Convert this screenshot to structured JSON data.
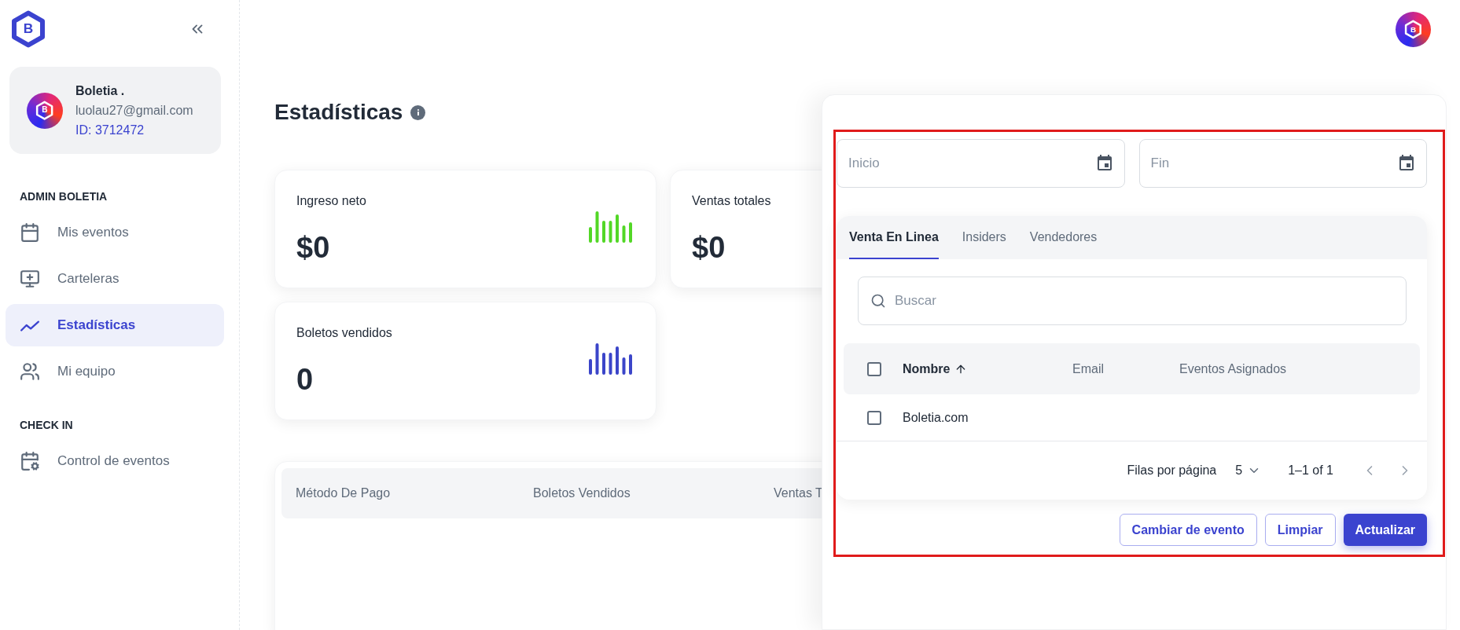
{
  "logo": {
    "letter": "B"
  },
  "profile": {
    "avatar_letter": "B",
    "name": "Boletia .",
    "email": "luolau27@gmail.com",
    "id": "ID: 3712472"
  },
  "nav_sections": [
    {
      "title": "ADMIN BOLETIA",
      "items": [
        {
          "label": "Mis eventos",
          "kind": "calendar",
          "selected": false
        },
        {
          "label": "Carteleras",
          "kind": "monitor",
          "selected": false
        },
        {
          "label": "Estadísticas",
          "kind": "trend",
          "selected": true
        },
        {
          "label": "Mi equipo",
          "kind": "team",
          "selected": false
        }
      ]
    },
    {
      "title": "CHECK IN",
      "items": [
        {
          "label": "Control de eventos",
          "kind": "checkin",
          "selected": false
        }
      ]
    }
  ],
  "account_avatar_letter": "B",
  "page_title": "Estadísticas",
  "stat_cards": [
    {
      "label": "Ingreso neto",
      "value": "$0",
      "color": "#52d726"
    },
    {
      "label": "Ventas totales",
      "value": "$0"
    },
    {
      "label": "Boletos vendidos",
      "value": "0",
      "color": "#3b45c9"
    }
  ],
  "payment_table": {
    "columns": [
      "Método De Pago",
      "Boletos Vendidos",
      "Ventas T"
    ]
  },
  "filter_panel": {
    "start_date": {
      "placeholder": "Inicio"
    },
    "end_date": {
      "placeholder": "Fin"
    },
    "tabs": [
      {
        "label": "Venta En Linea",
        "selected": true
      },
      {
        "label": "Insiders",
        "selected": false
      },
      {
        "label": "Vendedores",
        "selected": false
      }
    ],
    "search": {
      "placeholder": "Buscar"
    },
    "table": {
      "header_checked": false,
      "columns": [
        {
          "label": "Nombre",
          "sorted": true
        },
        {
          "label": "Email"
        },
        {
          "label": "Eventos Asignados"
        }
      ],
      "rows": [
        {
          "name": "Boletia.com",
          "checked": false
        }
      ]
    },
    "pagination": {
      "rows_label": "Filas por página",
      "page_size": "5",
      "range": "1–1 of 1"
    },
    "buttons": [
      {
        "label": "Cambiar de evento",
        "kind": "outline"
      },
      {
        "label": "Limpiar",
        "kind": "outline"
      },
      {
        "label": "Actualizar",
        "kind": "primary"
      }
    ]
  }
}
